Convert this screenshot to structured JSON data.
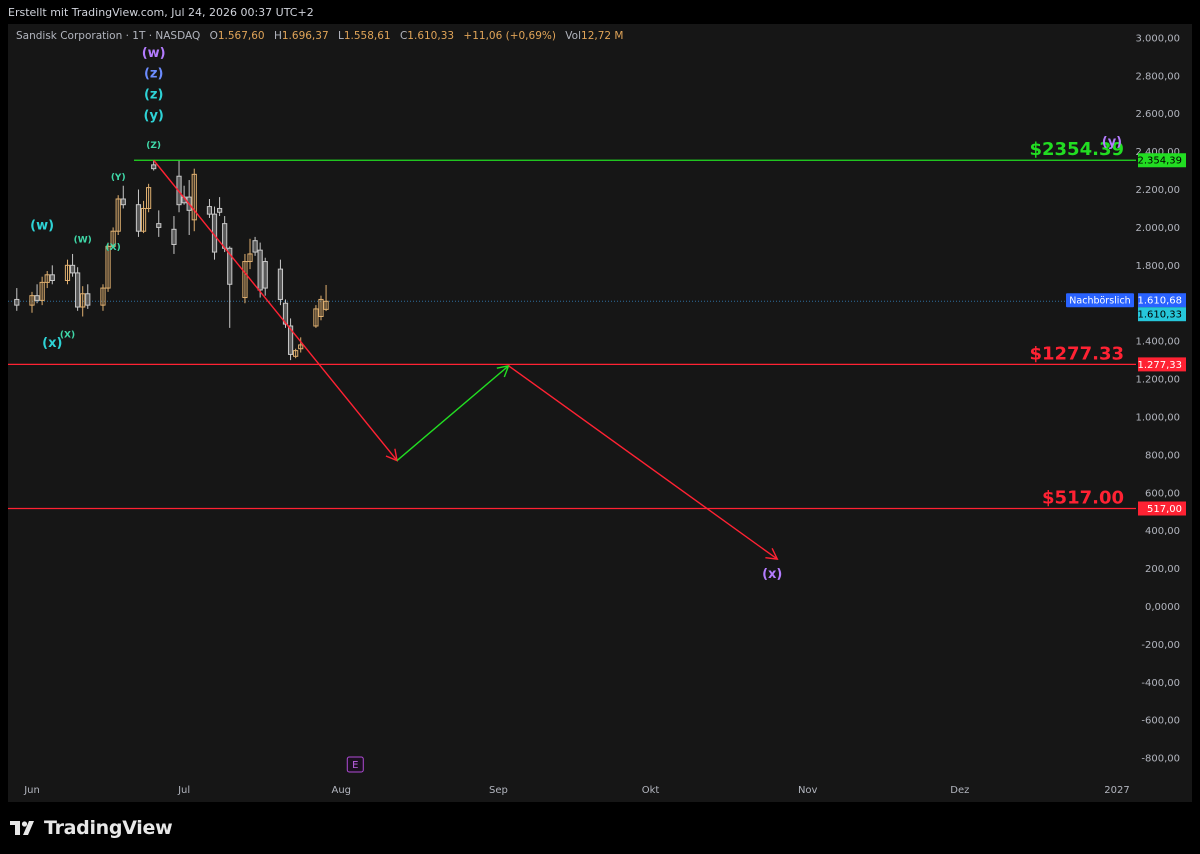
{
  "header": {
    "created_text": "Erstellt mit TradingView.com, Jul 24, 2026 00:37 UTC+2"
  },
  "legend": {
    "symbol": "Sandisk Corporation · 1T · NASDAQ",
    "open_label": "O",
    "open": "1.567,60",
    "high_label": "H",
    "high": "1.696,37",
    "low_label": "L",
    "low": "1.558,61",
    "close_label": "C",
    "close": "1.610,33",
    "change": "+11,06 (+0,69%)",
    "vol_label": "Vol",
    "vol": "12,72 M"
  },
  "brand": {
    "name": "TradingView"
  },
  "colors": {
    "background": "#161616",
    "candle_up": "#e0b070",
    "candle_down": "#c8c8c8",
    "green_line": "#22dd22",
    "red_line": "#ff2233",
    "wave_cyan": "#2ed3d6",
    "wave_purple": "#b47cff",
    "wave_green": "#3fd8a8",
    "axis_text": "#b2b5be"
  },
  "chart_data": {
    "type": "candlestick",
    "y_ticks": [
      {
        "value": 3000,
        "label": "3.000,00"
      },
      {
        "value": 2800,
        "label": "2.800,00"
      },
      {
        "value": 2600,
        "label": "2.600,00"
      },
      {
        "value": 2400,
        "label": "2.400,00"
      },
      {
        "value": 2200,
        "label": "2.200,00"
      },
      {
        "value": 2000,
        "label": "2.000,00"
      },
      {
        "value": 1800,
        "label": "1.800,00"
      },
      {
        "value": 1400,
        "label": "1.400,00"
      },
      {
        "value": 1200,
        "label": "1.200,00"
      },
      {
        "value": 1000,
        "label": "1.000,00"
      },
      {
        "value": 800,
        "label": "800,00"
      },
      {
        "value": 600,
        "label": "600,00"
      },
      {
        "value": 400,
        "label": "400,00"
      },
      {
        "value": 200,
        "label": "200,00"
      },
      {
        "value": 0,
        "label": "0,0000"
      },
      {
        "value": -200,
        "label": "-200,00"
      },
      {
        "value": -400,
        "label": "-400,00"
      },
      {
        "value": -600,
        "label": "-600,00"
      },
      {
        "value": -800,
        "label": "-800,00"
      }
    ],
    "x_ticks": [
      {
        "date": "2026-06-01",
        "label": "Jun"
      },
      {
        "date": "2026-07-01",
        "label": "Jul"
      },
      {
        "date": "2026-08-01",
        "label": "Aug"
      },
      {
        "date": "2026-09-01",
        "label": "Sep"
      },
      {
        "date": "2026-10-01",
        "label": "Okt"
      },
      {
        "date": "2026-11-01",
        "label": "Nov"
      },
      {
        "date": "2026-12-01",
        "label": "Dez"
      },
      {
        "date": "2027-01-01",
        "label": "2027"
      }
    ],
    "candles": [
      {
        "date": "2026-05-29",
        "o": 1620,
        "h": 1680,
        "l": 1560,
        "c": 1590
      },
      {
        "date": "2026-06-01",
        "o": 1590,
        "h": 1660,
        "l": 1550,
        "c": 1640
      },
      {
        "date": "2026-06-02",
        "o": 1640,
        "h": 1700,
        "l": 1600,
        "c": 1615
      },
      {
        "date": "2026-06-03",
        "o": 1615,
        "h": 1740,
        "l": 1590,
        "c": 1710
      },
      {
        "date": "2026-06-04",
        "o": 1710,
        "h": 1770,
        "l": 1680,
        "c": 1750
      },
      {
        "date": "2026-06-05",
        "o": 1750,
        "h": 1800,
        "l": 1700,
        "c": 1720
      },
      {
        "date": "2026-06-08",
        "o": 1720,
        "h": 1830,
        "l": 1700,
        "c": 1800
      },
      {
        "date": "2026-06-09",
        "o": 1800,
        "h": 1860,
        "l": 1740,
        "c": 1760
      },
      {
        "date": "2026-06-10",
        "o": 1760,
        "h": 1790,
        "l": 1560,
        "c": 1580
      },
      {
        "date": "2026-06-11",
        "o": 1580,
        "h": 1690,
        "l": 1530,
        "c": 1650
      },
      {
        "date": "2026-06-12",
        "o": 1650,
        "h": 1700,
        "l": 1570,
        "c": 1590
      },
      {
        "date": "2026-06-15",
        "o": 1590,
        "h": 1700,
        "l": 1560,
        "c": 1680
      },
      {
        "date": "2026-06-16",
        "o": 1680,
        "h": 1920,
        "l": 1660,
        "c": 1900
      },
      {
        "date": "2026-06-17",
        "o": 1900,
        "h": 2000,
        "l": 1890,
        "c": 1980
      },
      {
        "date": "2026-06-18",
        "o": 1980,
        "h": 2170,
        "l": 1960,
        "c": 2150
      },
      {
        "date": "2026-06-19",
        "o": 2150,
        "h": 2220,
        "l": 2100,
        "c": 2120
      },
      {
        "date": "2026-06-22",
        "o": 2120,
        "h": 2200,
        "l": 1950,
        "c": 1980
      },
      {
        "date": "2026-06-23",
        "o": 1980,
        "h": 2140,
        "l": 1970,
        "c": 2100
      },
      {
        "date": "2026-06-24",
        "o": 2100,
        "h": 2230,
        "l": 2080,
        "c": 2210
      },
      {
        "date": "2026-06-25",
        "o": 2330,
        "h": 2354,
        "l": 2300,
        "c": 2310
      },
      {
        "date": "2026-06-26",
        "o": 2020,
        "h": 2090,
        "l": 1950,
        "c": 2000
      },
      {
        "date": "2026-06-29",
        "o": 1990,
        "h": 2060,
        "l": 1860,
        "c": 1910
      },
      {
        "date": "2026-06-30",
        "o": 2270,
        "h": 2354,
        "l": 2080,
        "c": 2120
      },
      {
        "date": "2026-07-01",
        "o": 2160,
        "h": 2220,
        "l": 2120,
        "c": 2130
      },
      {
        "date": "2026-07-02",
        "o": 2160,
        "h": 2250,
        "l": 1960,
        "c": 2090
      },
      {
        "date": "2026-07-03",
        "o": 2040,
        "h": 2310,
        "l": 1980,
        "c": 2280
      },
      {
        "date": "2026-07-06",
        "o": 2110,
        "h": 2150,
        "l": 2050,
        "c": 2070
      },
      {
        "date": "2026-07-07",
        "o": 2070,
        "h": 2110,
        "l": 1830,
        "c": 1870
      },
      {
        "date": "2026-07-08",
        "o": 2100,
        "h": 2160,
        "l": 2060,
        "c": 2080
      },
      {
        "date": "2026-07-09",
        "o": 2020,
        "h": 2060,
        "l": 1870,
        "c": 1890
      },
      {
        "date": "2026-07-10",
        "o": 1890,
        "h": 1900,
        "l": 1470,
        "c": 1700
      },
      {
        "date": "2026-07-13",
        "o": 1630,
        "h": 1860,
        "l": 1600,
        "c": 1820
      },
      {
        "date": "2026-07-14",
        "o": 1820,
        "h": 1940,
        "l": 1780,
        "c": 1860
      },
      {
        "date": "2026-07-15",
        "o": 1930,
        "h": 1950,
        "l": 1850,
        "c": 1870
      },
      {
        "date": "2026-07-16",
        "o": 1880,
        "h": 1920,
        "l": 1630,
        "c": 1670
      },
      {
        "date": "2026-07-17",
        "o": 1820,
        "h": 1840,
        "l": 1640,
        "c": 1680
      },
      {
        "date": "2026-07-20",
        "o": 1780,
        "h": 1830,
        "l": 1590,
        "c": 1620
      },
      {
        "date": "2026-07-21",
        "o": 1600,
        "h": 1620,
        "l": 1470,
        "c": 1490
      },
      {
        "date": "2026-07-22",
        "o": 1480,
        "h": 1520,
        "l": 1300,
        "c": 1330
      },
      {
        "date": "2026-07-23",
        "o": 1320,
        "h": 1360,
        "l": 1310,
        "c": 1350
      },
      {
        "date": "2026-07-24",
        "o": 1360,
        "h": 1420,
        "l": 1340,
        "c": 1380
      },
      {
        "date": "2026-07-27",
        "o": 1480,
        "h": 1590,
        "l": 1470,
        "c": 1570
      },
      {
        "date": "2026-07-28",
        "o": 1530,
        "h": 1640,
        "l": 1510,
        "c": 1620
      },
      {
        "date": "2026-07-29",
        "o": 1567.6,
        "h": 1696.37,
        "l": 1558.61,
        "c": 1610.33
      }
    ],
    "levels": [
      {
        "name": "resistance",
        "value": 2354.39,
        "label": "$2354.39",
        "axis_label": "2.354,39",
        "color": "#22dd22"
      },
      {
        "name": "support-1",
        "value": 1277.33,
        "label": "$1277.33",
        "axis_label": "1.277,33",
        "color": "#ff2233"
      },
      {
        "name": "support-2",
        "value": 517.0,
        "label": "$517.00",
        "axis_label": "517,00",
        "color": "#ff2233"
      }
    ],
    "price_markers": [
      {
        "name": "after-hours",
        "text": "Nachbörslich",
        "value": 1610.68,
        "label": "1.610,68",
        "color": "#2962ff"
      },
      {
        "name": "last-price",
        "value": 1610.33,
        "label": "1.610,33",
        "color": "#26c6da"
      }
    ],
    "projection": [
      {
        "color": "#ff2233",
        "from": {
          "date": "2026-06-25",
          "price": 2354.39
        },
        "to": {
          "date": "2026-08-12",
          "price": 770
        },
        "arrow": true
      },
      {
        "color": "#22dd22",
        "from": {
          "date": "2026-08-12",
          "price": 770
        },
        "to": {
          "date": "2026-09-03",
          "price": 1270
        },
        "arrow": true
      },
      {
        "color": "#ff2233",
        "from": {
          "date": "2026-09-03",
          "price": 1270
        },
        "to": {
          "date": "2026-10-26",
          "price": 250
        },
        "arrow": true
      }
    ],
    "wave_labels": [
      {
        "text": "(w)",
        "date": "2026-06-25",
        "price": 2900,
        "color": "#b47cff",
        "size": 13
      },
      {
        "text": "(z)",
        "date": "2026-06-25",
        "price": 2790,
        "color": "#6c8cff",
        "size": 13
      },
      {
        "text": "(z)",
        "date": "2026-06-25",
        "price": 2680,
        "color": "#2ed3d6",
        "size": 13
      },
      {
        "text": "(y)",
        "date": "2026-06-25",
        "price": 2570,
        "color": "#2ed3d6",
        "size": 13
      },
      {
        "text": "(Z)",
        "date": "2026-06-25",
        "price": 2420,
        "color": "#3fd8a8",
        "size": 9
      },
      {
        "text": "(Y)",
        "date": "2026-06-18",
        "price": 2250,
        "color": "#3fd8a8",
        "size": 9
      },
      {
        "text": "(W)",
        "date": "2026-06-11",
        "price": 1920,
        "color": "#3fd8a8",
        "size": 9
      },
      {
        "text": "(X)",
        "date": "2026-06-17",
        "price": 1880,
        "color": "#3fd8a8",
        "size": 9
      },
      {
        "text": "(w)",
        "date": "2026-06-03",
        "price": 1990,
        "color": "#2ed3d6",
        "size": 13
      },
      {
        "text": "(x)",
        "date": "2026-06-05",
        "price": 1370,
        "color": "#2ed3d6",
        "size": 13
      },
      {
        "text": "(X)",
        "date": "2026-06-08",
        "price": 1420,
        "color": "#3fd8a8",
        "size": 9
      },
      {
        "text": "(y)",
        "date": "2026-12-31",
        "price": 2430,
        "color": "#b47cff",
        "size": 13
      },
      {
        "text": "(x)",
        "date": "2026-10-25",
        "price": 150,
        "color": "#b47cff",
        "size": 13
      }
    ],
    "event_marker": {
      "text": "E",
      "date": "2026-08-01"
    }
  }
}
